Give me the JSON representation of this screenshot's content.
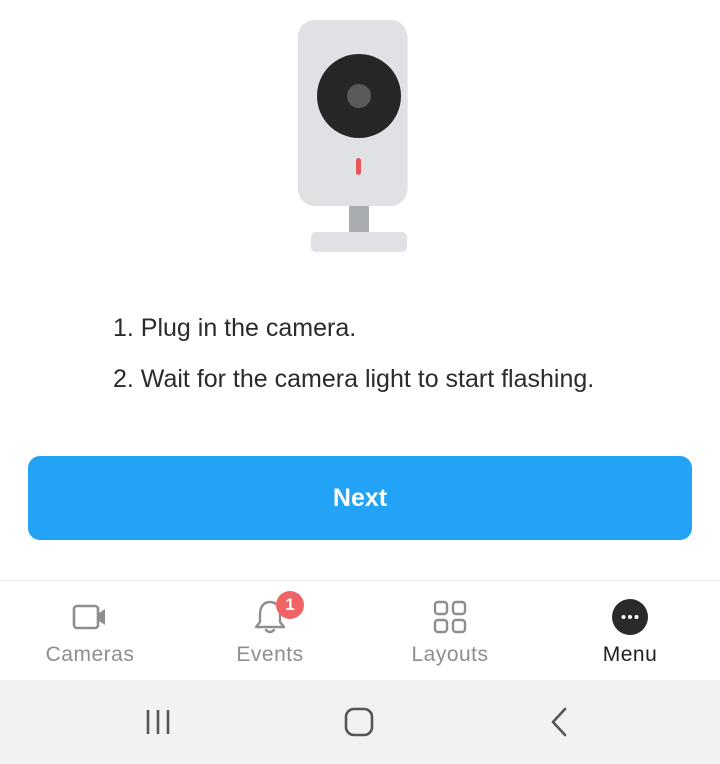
{
  "illustration": {
    "name": "security camera",
    "body_color": "#dfe1e4",
    "lens_color": "#262626",
    "indicator_color": "#e8545a"
  },
  "instructions": [
    {
      "text": "1. Plug in the camera."
    },
    {
      "text": "2. Wait for the camera light to start flashing."
    }
  ],
  "next_button": {
    "label": "Next",
    "color": "#22a3f5"
  },
  "tab_bar": {
    "tabs": [
      {
        "label": "Cameras",
        "icon": "video-camera-icon",
        "active": false
      },
      {
        "label": "Events",
        "icon": "bell-icon",
        "active": false,
        "badge": "1"
      },
      {
        "label": "Layouts",
        "icon": "grid-icon",
        "active": false
      },
      {
        "label": "Menu",
        "icon": "more-dots-icon",
        "active": true
      }
    ],
    "badge_color": "#f06466"
  },
  "system_nav": {
    "buttons": [
      {
        "icon": "recent-apps-icon"
      },
      {
        "icon": "home-icon"
      },
      {
        "icon": "back-icon"
      }
    ]
  }
}
